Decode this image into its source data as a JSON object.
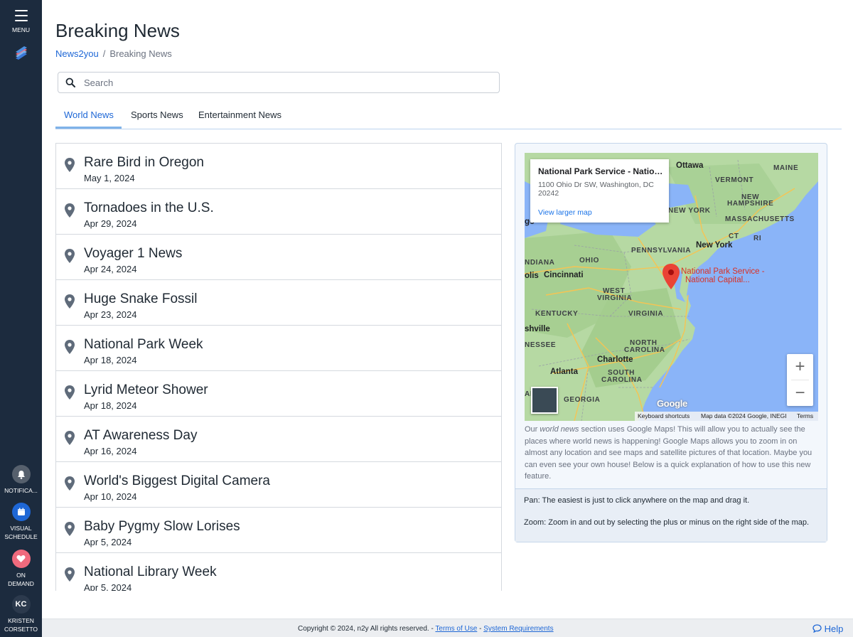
{
  "sidebar": {
    "menu_label": "MENU",
    "notifications_label": "NOTIFICA...",
    "visual_schedule_label_1": "VISUAL",
    "visual_schedule_label_2": "SCHEDULE",
    "on_demand_label_1": "ON",
    "on_demand_label_2": "DEMAND",
    "profile_initials": "KC",
    "profile_name_1": "KRISTEN",
    "profile_name_2": "CORSETTO"
  },
  "header": {
    "title": "Breaking News",
    "breadcrumb_root": "News2you",
    "breadcrumb_separator": "/",
    "breadcrumb_current": "Breaking News"
  },
  "search": {
    "placeholder": "Search",
    "value": ""
  },
  "tabs": [
    {
      "label": "World News",
      "active": true
    },
    {
      "label": "Sports News",
      "active": false
    },
    {
      "label": "Entertainment News",
      "active": false
    }
  ],
  "news_items": [
    {
      "title": "Rare Bird in Oregon",
      "date": "May 1, 2024"
    },
    {
      "title": "Tornadoes in the U.S.",
      "date": "Apr 29, 2024"
    },
    {
      "title": "Voyager 1 News",
      "date": "Apr 24, 2024"
    },
    {
      "title": "Huge Snake Fossil",
      "date": "Apr 23, 2024"
    },
    {
      "title": "National Park Week",
      "date": "Apr 18, 2024"
    },
    {
      "title": "Lyrid Meteor Shower",
      "date": "Apr 18, 2024"
    },
    {
      "title": "AT Awareness Day",
      "date": "Apr 16, 2024"
    },
    {
      "title": "World's Biggest Digital Camera",
      "date": "Apr 10, 2024"
    },
    {
      "title": "Baby Pygmy Slow Lorises",
      "date": "Apr 5, 2024"
    },
    {
      "title": "National Library Week",
      "date": "Apr 5, 2024"
    }
  ],
  "map": {
    "info_title": "National Park Service - National Capital Region",
    "info_address": "1100 Ohio Dr SW, Washington, DC 20242",
    "info_link": "View larger map",
    "pin_label_1": "National Park Service -",
    "pin_label_2": "National Capital...",
    "google_logo": "Google",
    "attrib_keyboard": "Keyboard shortcuts",
    "attrib_data": "Map data ©2024 Google, INEGI",
    "attrib_terms": "Terms",
    "zoom_in": "+",
    "zoom_out": "−",
    "labels": {
      "ottawa": "Ottawa",
      "maine": "MAINE",
      "vermont": "VERMONT",
      "new_hampshire_1": "NEW",
      "new_hampshire_2": "HAMPSHIRE",
      "new_york_state": "NEW YORK",
      "massachusetts": "MASSACHUSETTS",
      "ct": "CT",
      "ri": "RI",
      "pennsylvania": "PENNSYLVANIA",
      "new_york_city": "New York",
      "indiana": "NDIANA",
      "ohio": "OHIO",
      "cincinnati": "Cincinnati",
      "cincinnati_prefix": "olis",
      "west_virginia_1": "WEST",
      "west_virginia_2": "VIRGINIA",
      "kentucky": "KENTUCKY",
      "virginia": "VIRGINIA",
      "nashville": "shville",
      "tennessee": "NESSEE",
      "north_carolina_1": "NORTH",
      "north_carolina_2": "CAROLINA",
      "charlotte": "Charlotte",
      "atlanta": "Atlanta",
      "south_carolina_1": "SOUTH",
      "south_carolina_2": "CAROLINA",
      "georgia": "GEORGIA",
      "edge_go": "go",
      "edge_ae": "AE"
    }
  },
  "map_description": {
    "part1": "Our ",
    "emphasis": "world news",
    "part2": " section uses Google Maps! This will allow you to actually see the places where world news is happening! Google Maps allows you to zoom in on almost any location and see maps and satellite pictures of that location. Maybe you can even see your own house! Below is a quick explanation of how to use this new feature."
  },
  "howto": {
    "pan": "Pan: The easiest is just to click anywhere on the map and drag it.",
    "zoom": "Zoom: Zoom in and out by selecting the plus or minus on the right side of the map."
  },
  "footer": {
    "copyright": "Copyright © 2024, n2y All rights reserved. -",
    "terms": "Terms of Use",
    "dash": "-",
    "requirements": "System Requirements",
    "help": "Help"
  },
  "colors": {
    "sidebar_bg": "#1c2b3e",
    "accent": "#1e67d6",
    "ocean": "#8ab4f8",
    "land": "#b6d9a3",
    "map_pin": "#ea4335",
    "on_demand": "#f06a7d"
  }
}
